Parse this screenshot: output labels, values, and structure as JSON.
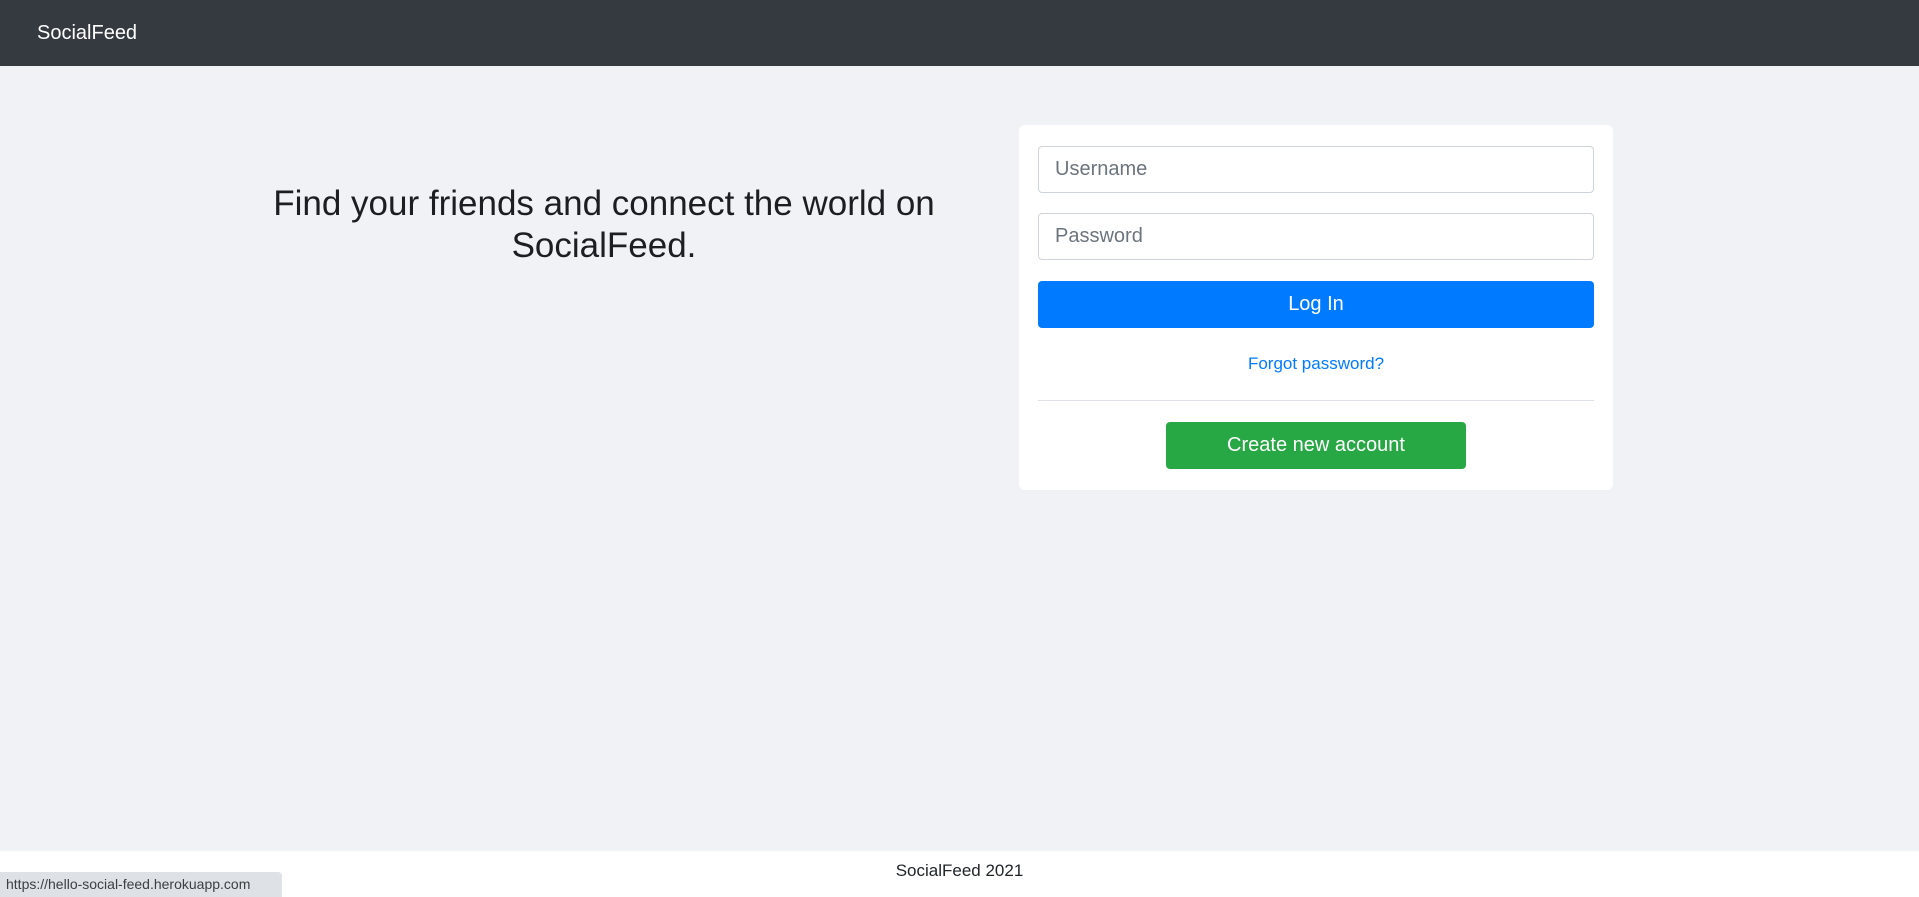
{
  "navbar": {
    "brand": "SocialFeed"
  },
  "hero": {
    "tagline": "Find your friends and connect the world on SocialFeed."
  },
  "login_card": {
    "username_placeholder": "Username",
    "password_placeholder": "Password",
    "login_label": "Log In",
    "forgot_label": "Forgot password?",
    "create_label": "Create new account"
  },
  "footer": {
    "text": "SocialFeed 2021"
  },
  "status_bar": {
    "url": "https://hello-social-feed.herokuapp.com"
  },
  "colors": {
    "navbar_bg": "#343a40",
    "page_bg": "#f0f2f5",
    "primary": "#007bff",
    "success": "#28a745"
  }
}
